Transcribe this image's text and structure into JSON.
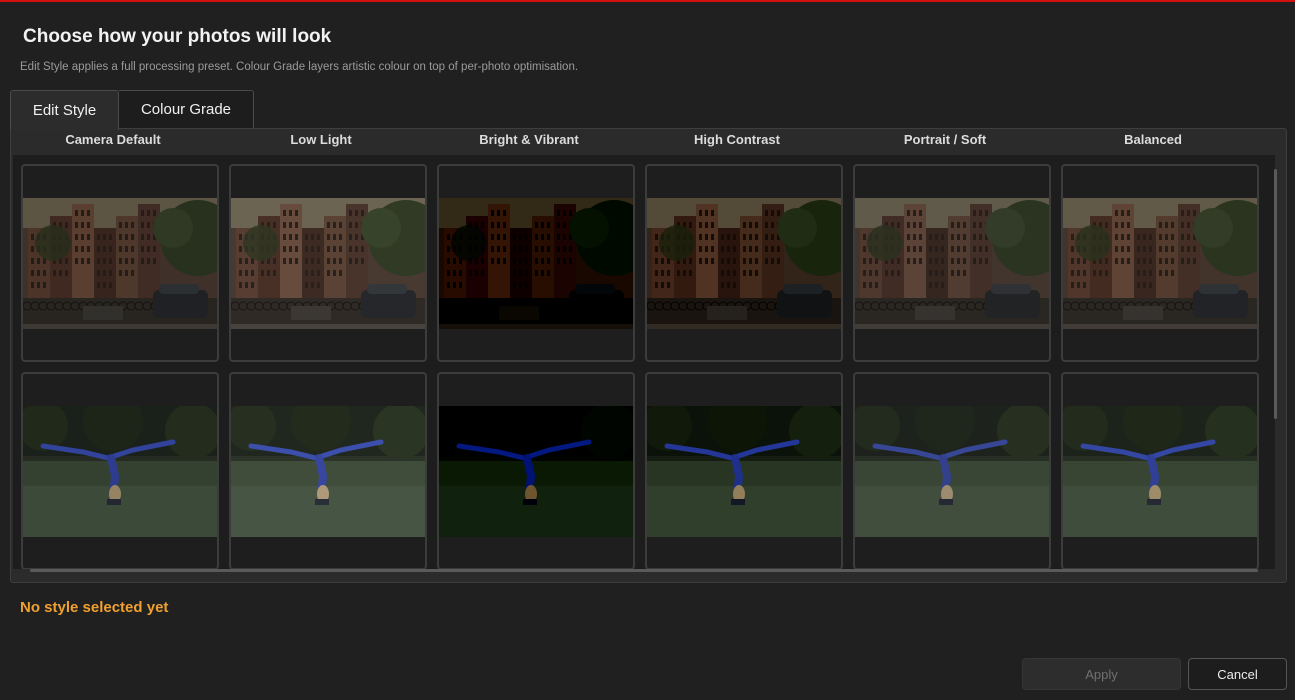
{
  "dialog": {
    "title": "Choose how your photos will look",
    "subtitle": "Edit Style applies a full processing preset. Colour Grade layers artistic colour on top of per-photo optimisation.",
    "accent_color": "#d40f0f"
  },
  "tabs": [
    {
      "label": "Edit Style",
      "active": true
    },
    {
      "label": "Colour Grade",
      "active": false
    }
  ],
  "styles": [
    "Camera Default",
    "Low Light",
    "Bright & Vibrant",
    "High Contrast",
    "Portrait / Soft",
    "Balanced"
  ],
  "photos": [
    "street-scene",
    "cartwheel-scene"
  ],
  "status": {
    "text": "No style selected yet",
    "color": "#f0a030"
  },
  "buttons": {
    "apply": "Apply",
    "cancel": "Cancel",
    "apply_enabled": false
  }
}
